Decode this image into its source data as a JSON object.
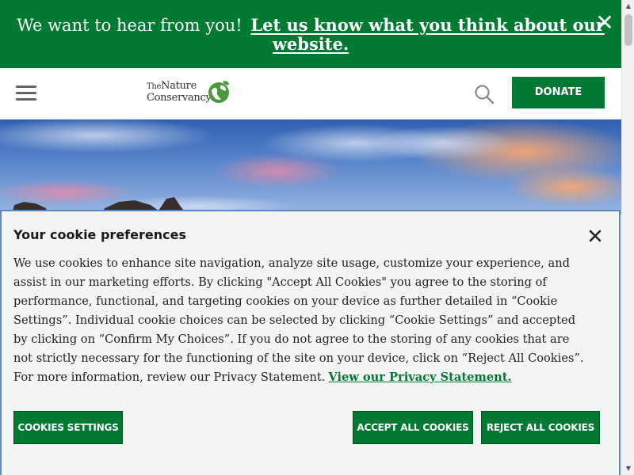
{
  "banner": {
    "intro": "We want to hear from you!",
    "link": "Let us know what you think about our website.",
    "close_icon": "close-icon"
  },
  "header": {
    "menu_icon": "hamburger-menu-icon",
    "logo": {
      "line1_small": "The",
      "line1": "Nature",
      "line2": "Conservancy"
    },
    "search_icon": "search-icon",
    "donate_label": "DONATE"
  },
  "hero": {
    "description": "sunset-sky-over-rocky-coast"
  },
  "cookie": {
    "title": "Your cookie preferences",
    "body": "We use cookies to enhance site navigation, analyze site usage, customize your experience, and assist in our marketing efforts. By clicking \"Accept All Cookies\" you agree to the storing of performance, functional, and targeting cookies on your device as further detailed in “Cookie Settings”. Individual cookie choices can be selected by clicking “Cookie Settings” and accepted by clicking on “Confirm My Choices”. If you do not agree to the storing of any cookies that are not strictly necessary for the functioning of the site on your device, click on “Reject All Cookies”. For more information, review our Privacy Statement.",
    "privacy_link": "View our Privacy Statement.",
    "settings_label": "COOKIES SETTINGS",
    "accept_label": "ACCEPT ALL COOKIES",
    "reject_label": "REJECT ALL COOKIES"
  },
  "colors": {
    "brand_green": "#007a33",
    "dialog_border": "#5b86c4"
  }
}
